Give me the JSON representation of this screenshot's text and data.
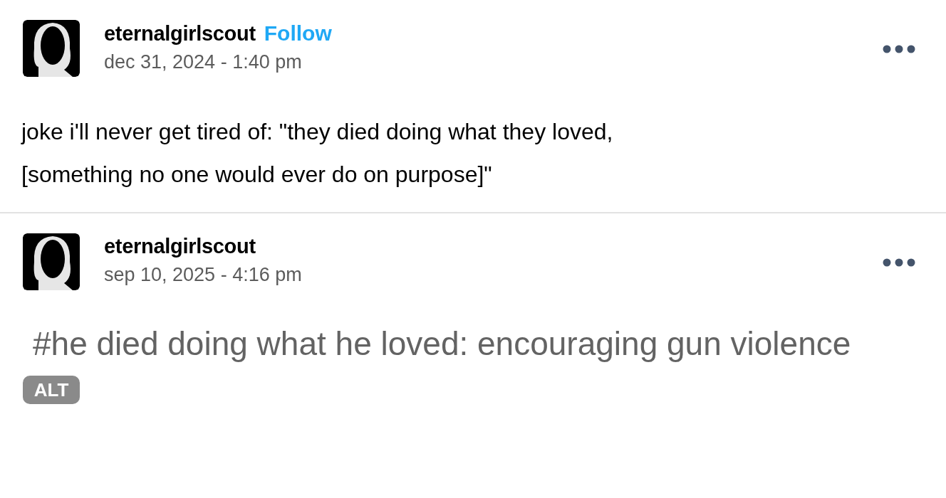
{
  "posts": [
    {
      "author": "eternalgirlscout",
      "follow": "Follow",
      "date": "dec 31, 2024 - 1:40 pm",
      "body": {
        "kind": "text",
        "lines": [
          "joke i'll never get tired of: \"they died doing what they loved,",
          "[something no one would ever do on purpose]\""
        ]
      }
    },
    {
      "author": "eternalgirlscout",
      "date": "sep 10, 2025 - 4:16 pm",
      "body": {
        "kind": "image",
        "text": "#he died doing what he loved: encouraging gun violence",
        "badge": "ALT"
      }
    }
  ]
}
